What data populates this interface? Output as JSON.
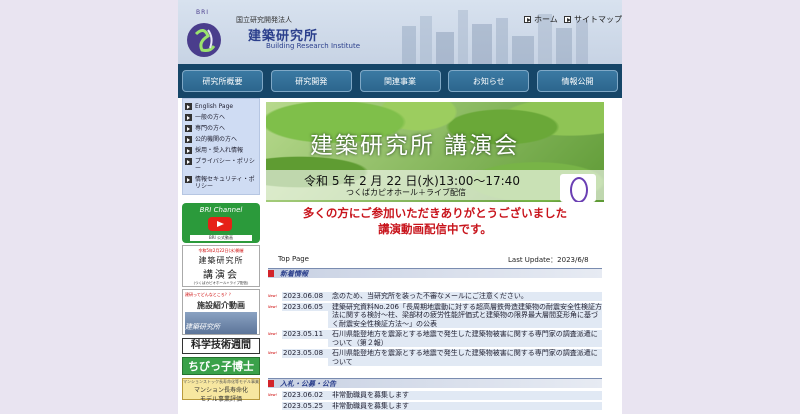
{
  "header": {
    "logo_text": "BRI",
    "org_sub": "国立研究開発法人",
    "org_name": "建築研究所",
    "org_en": "Building Research Institute",
    "links": [
      "ホーム",
      "サイトマップ"
    ]
  },
  "nav": [
    "研究所概要",
    "研究開発",
    "関連事業",
    "お知らせ",
    "情報公開"
  ],
  "sidebar": {
    "items": [
      {
        "label": "English Page"
      },
      {
        "label": "一般の方へ"
      },
      {
        "label": "専門の方へ"
      },
      {
        "label": "公的機関の方へ"
      },
      {
        "label": "採用・受入れ情報"
      },
      {
        "label": "プライバシー・ポリシー"
      },
      {
        "label": "情報セキュリティ・ポリシー"
      }
    ],
    "banners": {
      "channel_title": "BRI Channel",
      "channel_sub": "BRI 公式動画",
      "lecture_date": "令和5年2月22日(水)開催",
      "lecture_line1": "建築研究所",
      "lecture_line2": "講演会",
      "lecture_line3": "(つくばカピオホール+ライブ配信)",
      "fes_q": "建研ってどんなところ？？",
      "fes_main": "施設紹介動画",
      "fes_label": "建築研究所",
      "science": "科学技術週間",
      "kids": "ちびっ子博士",
      "mansion_small": "マンションストック長寿命化等モデル事業",
      "mansion_a": "マンション長寿命化",
      "mansion_b": "モデル事業評価"
    }
  },
  "hero": {
    "title": "建築研究所 講演会",
    "date": "令和 5 年 2 月 22 日(水)13:00～17:40",
    "venue": "つくばカピオホール＋ライブ配信"
  },
  "thanks": {
    "line1": "多くの方にご参加いただきありがとうございました",
    "line2": "講演動画配信中です。"
  },
  "crumb": "Top Page",
  "last_update": "Last Update：2023/6/8",
  "sections": {
    "news_title": "新着情報",
    "bid_title": "入札・公募・公告"
  },
  "news": [
    {
      "badge": "New!",
      "date": "2023.06.08",
      "text": "念のため、当研究所を装った不審なメールにご注意ください。"
    },
    {
      "badge": "New!",
      "date": "2023.06.05",
      "text": "建築研究資料No.206「長周期地震動に対する超高層鉄骨造建築物の耐震安全性検証方法に関する検討～柱、梁部材の疲労性能評価式と建築物の限界最大層間変形角に基づく耐震安全性検証方法～」の公表"
    },
    {
      "badge": "New!",
      "date": "2023.05.11",
      "text": "石川県能登地方を震源とする地震で発生した建築物被害に関する専門家の調査派遣について（第２報）"
    },
    {
      "badge": "New!",
      "date": "2023.05.08",
      "text": "石川県能登地方を震源とする地震で発生した建築物被害に関する専門家の調査派遣について"
    }
  ],
  "bids": [
    {
      "badge": "New!",
      "date": "2023.06.02",
      "text": "非常勤職員を募集します"
    },
    {
      "badge": "",
      "date": "2023.05.25",
      "text": "非常勤職員を募集します"
    }
  ]
}
